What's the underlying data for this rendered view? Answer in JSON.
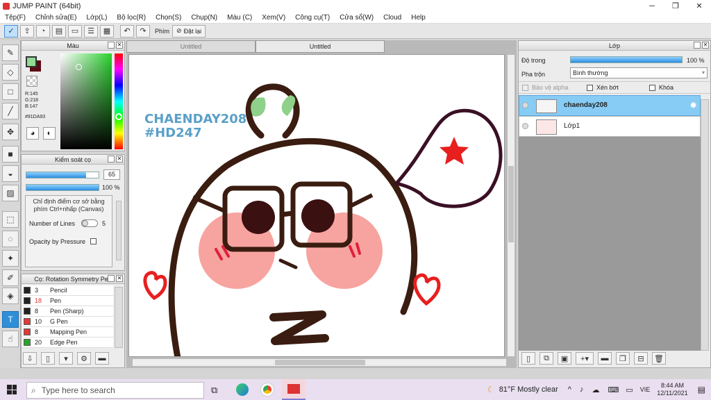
{
  "window": {
    "title": "JUMP PAINT (64bit)",
    "minimize": "─",
    "maximize": "❐",
    "close": "✕"
  },
  "menu": [
    "Tệp(F)",
    "Chỉnh sửa(E)",
    "Lớp(L)",
    "Bộ lọc(R)",
    "Chọn(S)",
    "Chụp(N)",
    "Màu (C)",
    "Xem(V)",
    "Công cụ(T)",
    "Cửa sổ(W)",
    "Cloud",
    "Help"
  ],
  "toolbar": {
    "shortcut_label": "Phím",
    "reset_label": "Đặt lại"
  },
  "color_panel": {
    "title": "Màu",
    "rgb": [
      "R:145",
      "G:218",
      "B:147"
    ],
    "hex": "#91DA93",
    "primary_color": "#91DA93",
    "secondary_color": "#5a0a14"
  },
  "brush_control": {
    "title": "Kiểm soát cọ",
    "size_value": "65",
    "size_fraction": 0.83,
    "opacity_value": "100 %",
    "opacity_fraction": 1.0,
    "hint": "Chỉ định điểm cơ sở bằng phím Ctrl+nhấp (Canvas)",
    "lines_label": "Number of Lines",
    "lines_value": "5",
    "pressure_label": "Opacity by Pressure"
  },
  "brush_list": {
    "title": "Cọ: Rotation Symmetry Pen",
    "items": [
      {
        "size": "3",
        "name": "Pencil",
        "color": "#222222"
      },
      {
        "size": "18",
        "name": "Pen",
        "color": "#222222"
      },
      {
        "size": "8",
        "name": "Pen (Sharp)",
        "color": "#222222"
      },
      {
        "size": "10",
        "name": "G Pen",
        "color": "#e03a3a"
      },
      {
        "size": "8",
        "name": "Mapping Pen",
        "color": "#e03a3a"
      },
      {
        "size": "20",
        "name": "Edge Pen",
        "color": "#2aa52a"
      }
    ]
  },
  "tabs": [
    "Untitled",
    "Untitled"
  ],
  "canvas": {
    "text_line1": "CHAENDAY208",
    "text_line2": "#HD247"
  },
  "layers_panel": {
    "title": "Lớp",
    "opacity_label": "Độ trong",
    "opacity_value": "100 %",
    "blend_label": "Pha trộn",
    "blend_value": "Bình thường",
    "protect_alpha": "Bảo vệ alpha",
    "clip": "Xén bớt",
    "lock": "Khóa",
    "layers": [
      {
        "name": "chaenday208",
        "selected": true
      },
      {
        "name": "Lớp1",
        "selected": false
      }
    ]
  },
  "taskbar": {
    "search_placeholder": "Type here to search",
    "weather": "81°F  Mostly clear",
    "lang": "VIE",
    "time": "8:44 AM",
    "date": "12/11/2021"
  }
}
